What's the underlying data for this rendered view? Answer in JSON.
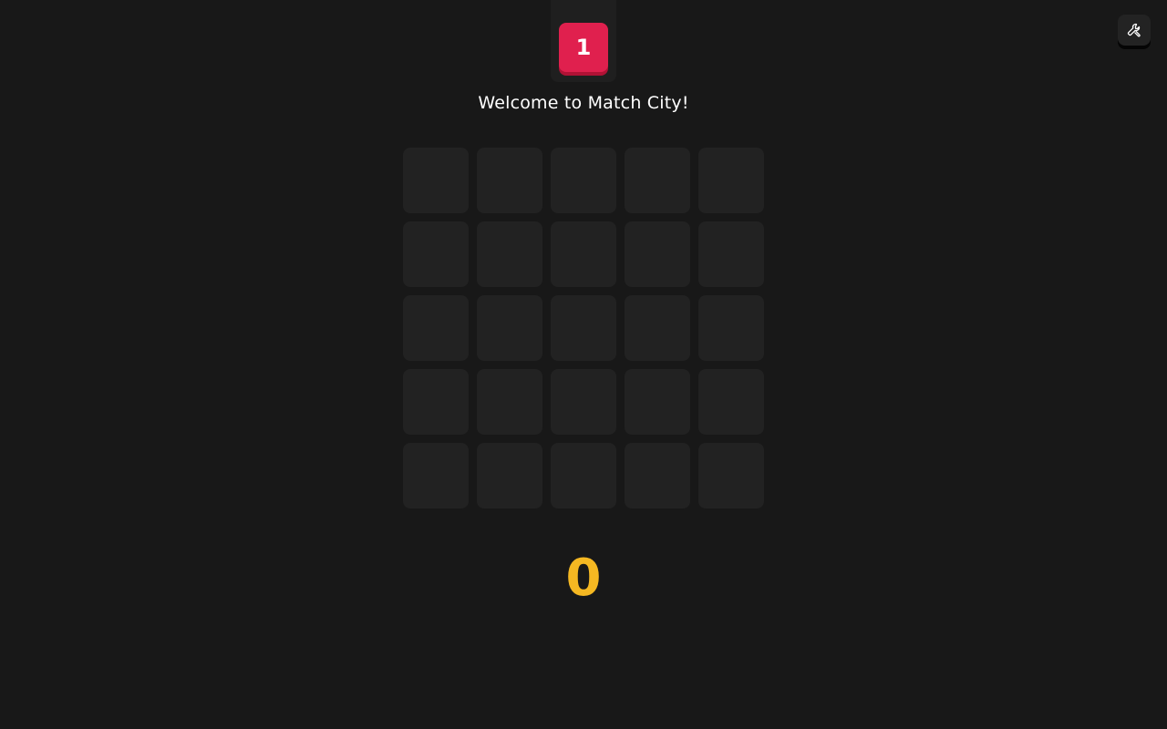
{
  "next_tile": {
    "label": "1",
    "color": "#e0204e"
  },
  "message": "Welcome to Match City!",
  "board": {
    "rows": 5,
    "cols": 5,
    "cells": [
      [
        "",
        "",
        "",
        "",
        ""
      ],
      [
        "",
        "",
        "",
        "",
        ""
      ],
      [
        "",
        "",
        "",
        "",
        ""
      ],
      [
        "",
        "",
        "",
        "",
        ""
      ],
      [
        "",
        "",
        "",
        "",
        ""
      ]
    ]
  },
  "score": {
    "value": "0",
    "color": "#f5b822"
  },
  "tools_button": {
    "icon": "wrench-icon"
  }
}
